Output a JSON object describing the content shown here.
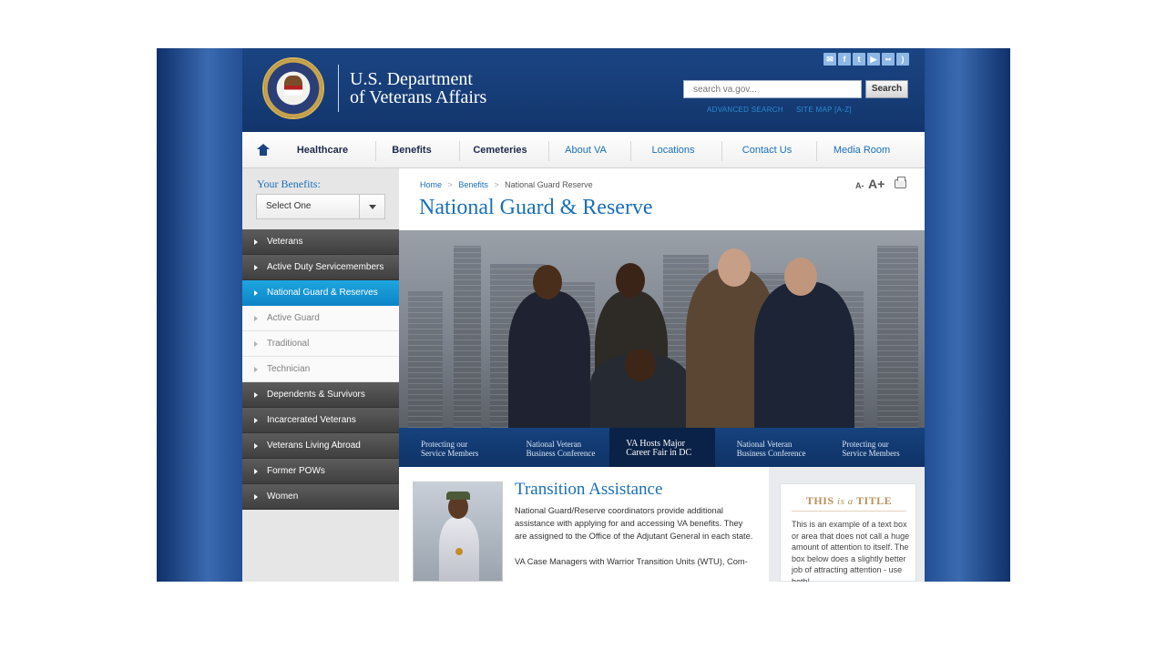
{
  "header": {
    "logo_line1": "U.S. Department",
    "logo_line2": "of Veterans Affairs",
    "search_placeholder": "search va.gov...",
    "search_button": "Search",
    "advanced_search": "ADVANCED SEARCH",
    "site_map": "SITE MAP [A-Z]",
    "social_icons": [
      "email-icon",
      "facebook-icon",
      "twitter-icon",
      "youtube-icon",
      "flickr-icon",
      "rss-icon"
    ]
  },
  "topnav": {
    "items": [
      {
        "label": "Healthcare"
      },
      {
        "label": "Benefits"
      },
      {
        "label": "Cemeteries"
      },
      {
        "label": "About VA"
      },
      {
        "label": "Locations"
      },
      {
        "label": "Contact Us"
      },
      {
        "label": "Media Room"
      }
    ]
  },
  "sidebar": {
    "heading": "Your Benefits:",
    "select_value": "Select One",
    "items": [
      {
        "label": "Veterans"
      },
      {
        "label": "Active Duty Servicemembers"
      },
      {
        "label": "National Guard & Reserves"
      },
      {
        "label": "Active Guard"
      },
      {
        "label": "Traditional"
      },
      {
        "label": "Technician"
      },
      {
        "label": "Dependents & Survivors"
      },
      {
        "label": "Incarcerated Veterans"
      },
      {
        "label": "Veterans Living Abroad"
      },
      {
        "label": "Former POWs"
      },
      {
        "label": "Women"
      }
    ]
  },
  "main": {
    "breadcrumb": {
      "home": "Home",
      "sep": ">",
      "benefits": "Benefits",
      "current": "National Guard Reserve"
    },
    "textsize_small": "A-",
    "textsize_big": "A+",
    "page_title": "National Guard & Reserve",
    "carousel": [
      {
        "line1": "Protecting our",
        "line2": "Service Members"
      },
      {
        "line1": "National Veteran",
        "line2": "Business Conference"
      },
      {
        "line1": "VA Hosts Major",
        "line2": "Career Fair in DC"
      },
      {
        "line1": "National Veteran",
        "line2": "Business Conference"
      },
      {
        "line1": "Protecting our",
        "line2": "Service Members"
      }
    ],
    "article": {
      "title": "Transition Assistance",
      "para1": "National Guard/Reserve coordinators provide additional assistance with applying for and accessing VA benefits. They are assigned to the Office of the Adjutant General in each state.",
      "para2": "VA Case Managers with Warrior Transition Units (WTU), Com-"
    },
    "aside": {
      "title_pre": "THIS",
      "title_mid": "is a",
      "title_post": "TITLE",
      "text": "This is an example of a text box or area that does not call a huge amount of attention to itself.  The box below does a slightly better job of attracting attention - use both!"
    }
  },
  "colors": {
    "brand_blue": "#1a4482",
    "link_blue": "#1a6fb8",
    "active_menu": "#0d84c6",
    "aside_title": "#b9905a"
  }
}
